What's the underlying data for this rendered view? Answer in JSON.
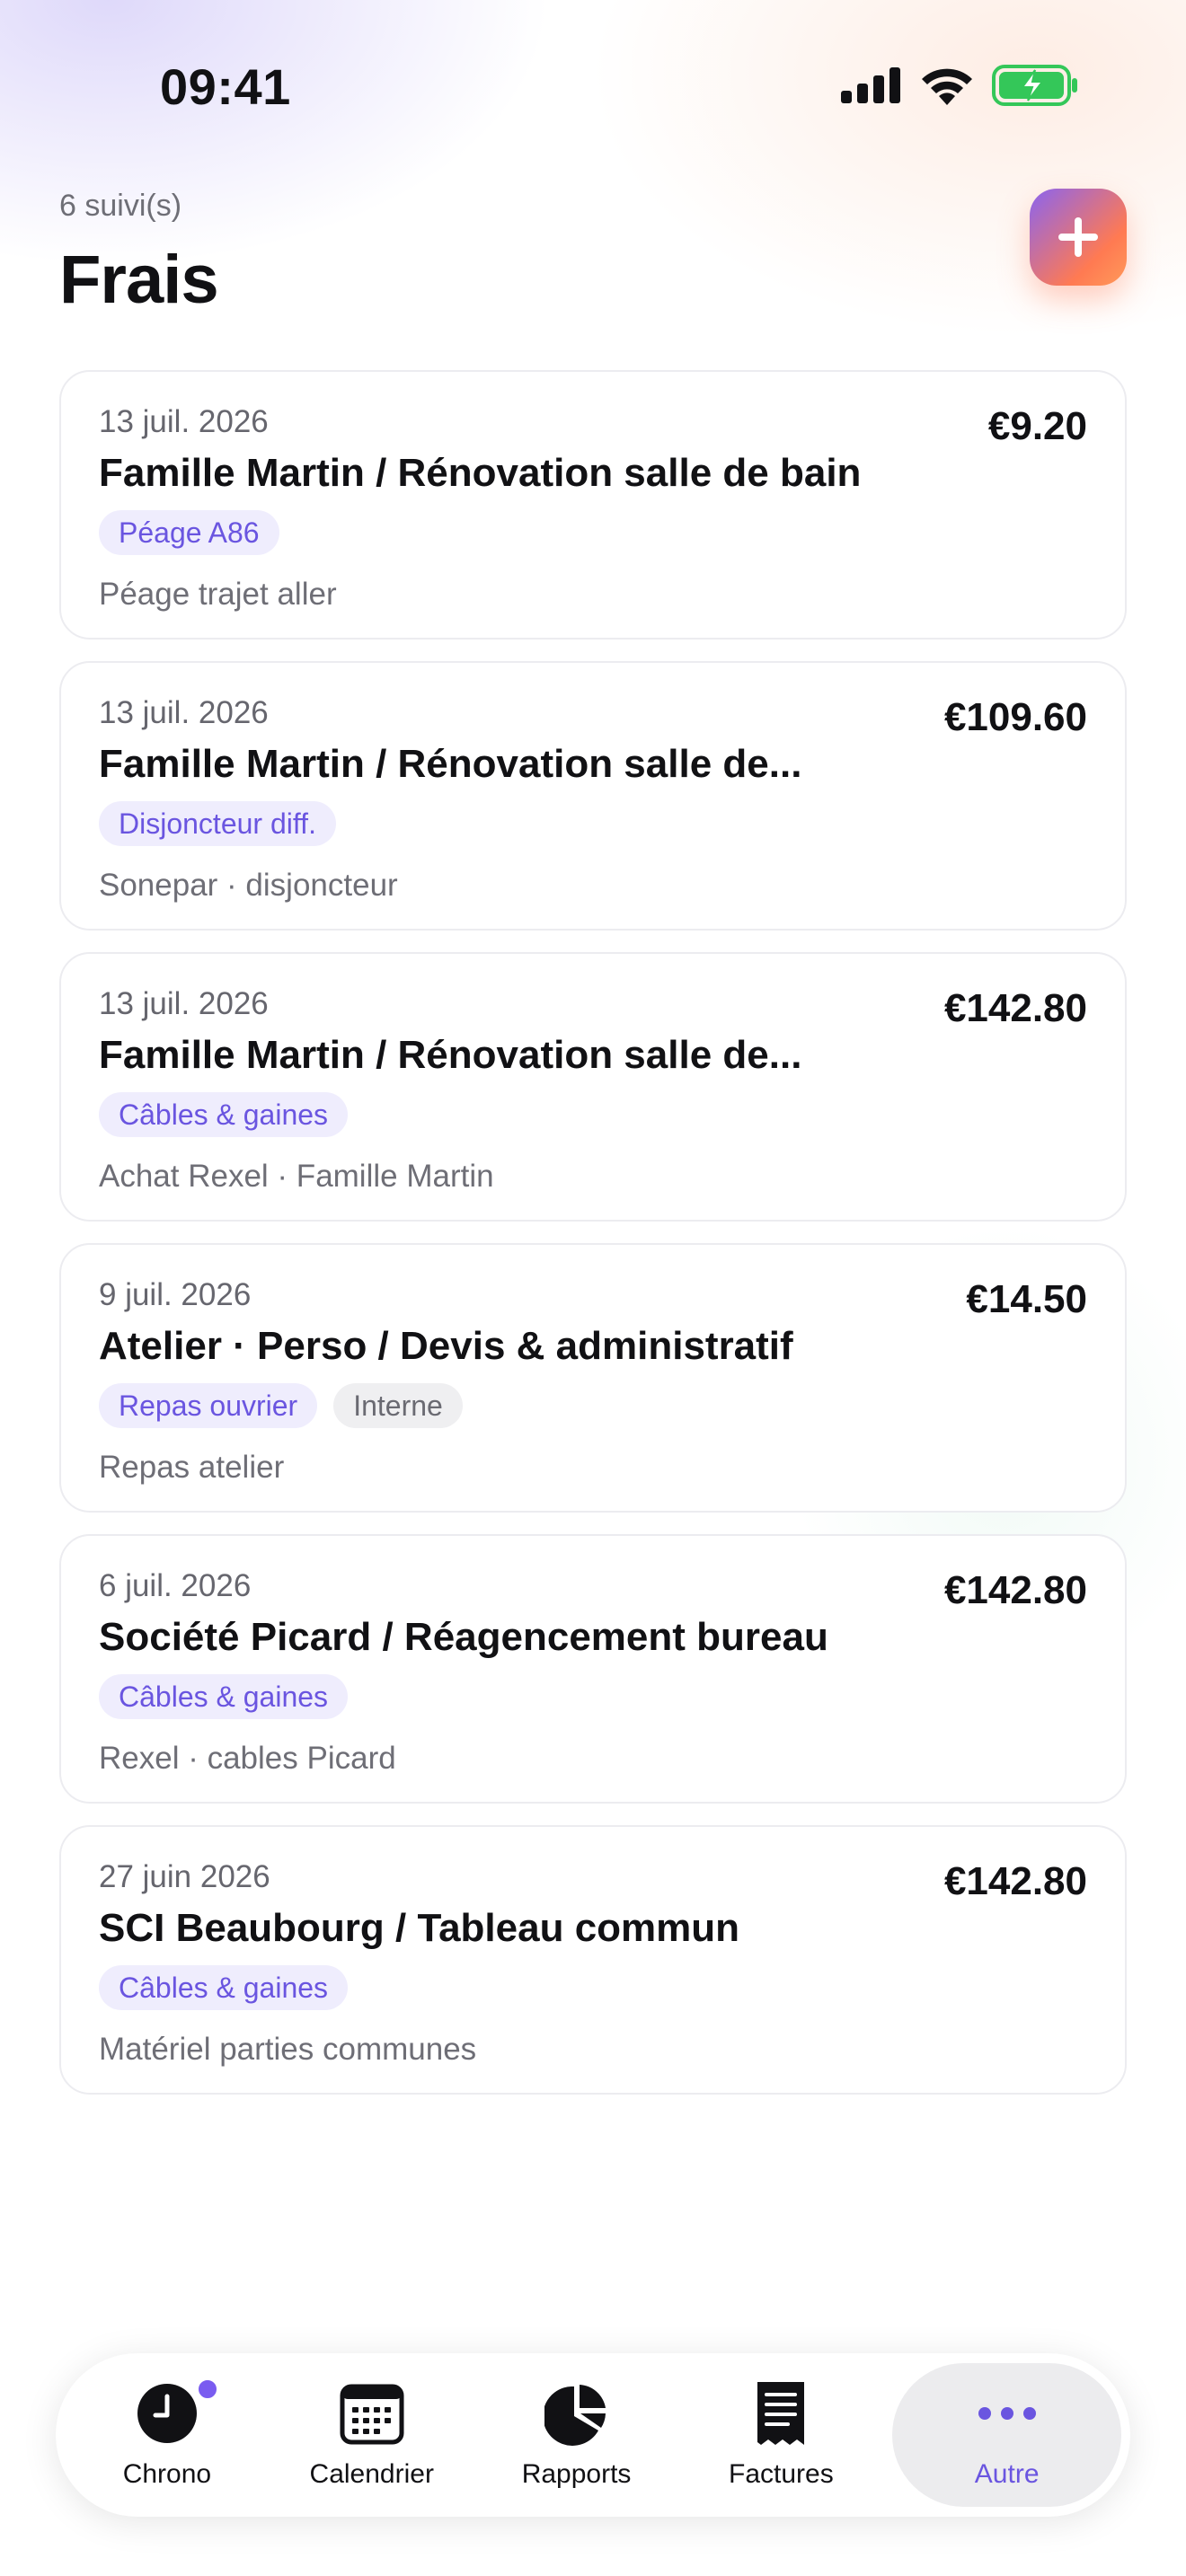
{
  "status_bar": {
    "time": "09:41",
    "icons": [
      "cellular-signal-icon",
      "wifi-icon",
      "battery-charging-icon"
    ]
  },
  "header": {
    "count": "6 suivi(s)",
    "title": "Frais",
    "add_icon": "plus-icon"
  },
  "expenses": [
    {
      "date": "13 juil. 2026",
      "amount": "€9.20",
      "title": "Famille Martin / Rénovation salle de bain",
      "tags": [
        {
          "label": "Péage A86",
          "style": "purple"
        }
      ],
      "note": "Péage trajet aller"
    },
    {
      "date": "13 juil. 2026",
      "amount": "€109.60",
      "title": "Famille Martin / Rénovation salle de...",
      "tags": [
        {
          "label": "Disjoncteur diff.",
          "style": "purple"
        }
      ],
      "note": "Sonepar · disjoncteur"
    },
    {
      "date": "13 juil. 2026",
      "amount": "€142.80",
      "title": "Famille Martin / Rénovation salle de...",
      "tags": [
        {
          "label": "Câbles & gaines",
          "style": "purple"
        }
      ],
      "note": "Achat Rexel · Famille Martin"
    },
    {
      "date": "9 juil. 2026",
      "amount": "€14.50",
      "title": "Atelier · Perso / Devis & administratif",
      "tags": [
        {
          "label": "Repas ouvrier",
          "style": "purple"
        },
        {
          "label": "Interne",
          "style": "gray"
        }
      ],
      "note": "Repas atelier"
    },
    {
      "date": "6 juil. 2026",
      "amount": "€142.80",
      "title": "Société Picard / Réagencement bureau",
      "tags": [
        {
          "label": "Câbles & gaines",
          "style": "purple"
        }
      ],
      "note": "Rexel · cables Picard"
    },
    {
      "date": "27 juin 2026",
      "amount": "€142.80",
      "title": "SCI Beaubourg / Tableau commun",
      "tags": [
        {
          "label": "Câbles & gaines",
          "style": "purple"
        }
      ],
      "note": "Matériel parties communes"
    }
  ],
  "tab_bar": {
    "tabs": [
      {
        "label": "Chrono",
        "icon": "clock-icon",
        "badge": true
      },
      {
        "label": "Calendrier",
        "icon": "calendar-icon"
      },
      {
        "label": "Rapports",
        "icon": "pie-chart-icon"
      },
      {
        "label": "Factures",
        "icon": "receipt-icon"
      },
      {
        "label": "Autre",
        "icon": "more-icon",
        "active": true
      }
    ]
  },
  "colors": {
    "accent": "#6a55e0",
    "tag_purple_bg": "#efedfd",
    "add_gradient_start": "#8a64f0",
    "add_gradient_end": "#ff7a52",
    "battery_green": "#34c759"
  }
}
